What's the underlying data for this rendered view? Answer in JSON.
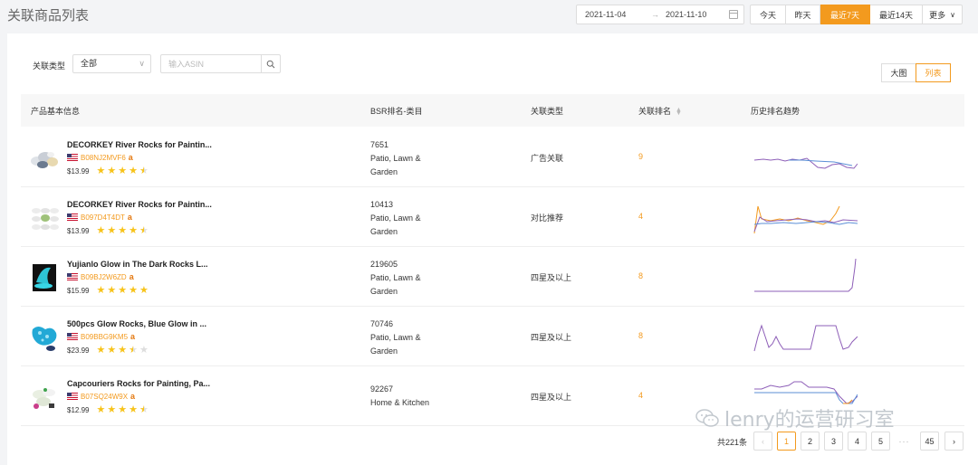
{
  "header": {
    "title": "关联商品列表",
    "date_start": "2021-11-04",
    "date_end": "2021-11-10",
    "range_buttons": [
      {
        "label": "今天"
      },
      {
        "label": "昨天"
      },
      {
        "label": "最近7天"
      },
      {
        "label": "最近14天"
      },
      {
        "label": "更多"
      }
    ],
    "active_range": "最近7天"
  },
  "filters": {
    "relation_label": "关联类型",
    "relation_value": "全部",
    "search_placeholder": "输入ASIN"
  },
  "view_toggle": {
    "big": "大图",
    "list": "列表",
    "active": "列表"
  },
  "table": {
    "columns": [
      "产品基本信息",
      "BSR排名-类目",
      "关联类型",
      "关联排名",
      "历史排名趋势"
    ],
    "rows": [
      {
        "name": "DECORKEY River Rocks for Paintin...",
        "asin": "B08NJ2MVF6",
        "price": "$13.99",
        "rating": 4.5,
        "bsr": "7651",
        "category_line1": "Patio, Lawn &",
        "category_line2": "Garden",
        "relation": "广告关联",
        "rank": "9"
      },
      {
        "name": "DECORKEY River Rocks for Paintin...",
        "asin": "B097D4T4DT",
        "price": "$13.99",
        "rating": 4.5,
        "bsr": "10413",
        "category_line1": "Patio, Lawn &",
        "category_line2": "Garden",
        "relation": "对比推荐",
        "rank": "4"
      },
      {
        "name": "Yujianlo Glow in The Dark Rocks L...",
        "asin": "B09BJ2W6ZD",
        "price": "$15.99",
        "rating": 5,
        "bsr": "219605",
        "category_line1": "Patio, Lawn &",
        "category_line2": "Garden",
        "relation": "四星及以上",
        "rank": "8"
      },
      {
        "name": "500pcs Glow Rocks, Blue Glow in ...",
        "asin": "B09BBG9KM5",
        "price": "$23.99",
        "rating": 3.5,
        "bsr": "70746",
        "category_line1": "Patio, Lawn &",
        "category_line2": "Garden",
        "relation": "四星及以上",
        "rank": "8"
      },
      {
        "name": "Capcouriers Rocks for Painting, Pa...",
        "asin": "B07SQ24W9X",
        "price": "$12.99",
        "rating": 4.5,
        "bsr": "92267",
        "category_line1": "Home & Kitchen",
        "category_line2": "",
        "relation": "四星及以上",
        "rank": "4"
      }
    ]
  },
  "pagination": {
    "total": "共221条",
    "pages": [
      "1",
      "2",
      "3",
      "4",
      "5"
    ],
    "ellipsis": "···",
    "last": "45",
    "current": "1"
  },
  "watermark": "lenry的运营研习室",
  "colors": {
    "accent": "#f39a1e",
    "star": "#f7c31a",
    "trend_purple": "#8e5fb8",
    "trend_blue": "#5b8fd6",
    "trend_orange": "#f39a1e"
  }
}
